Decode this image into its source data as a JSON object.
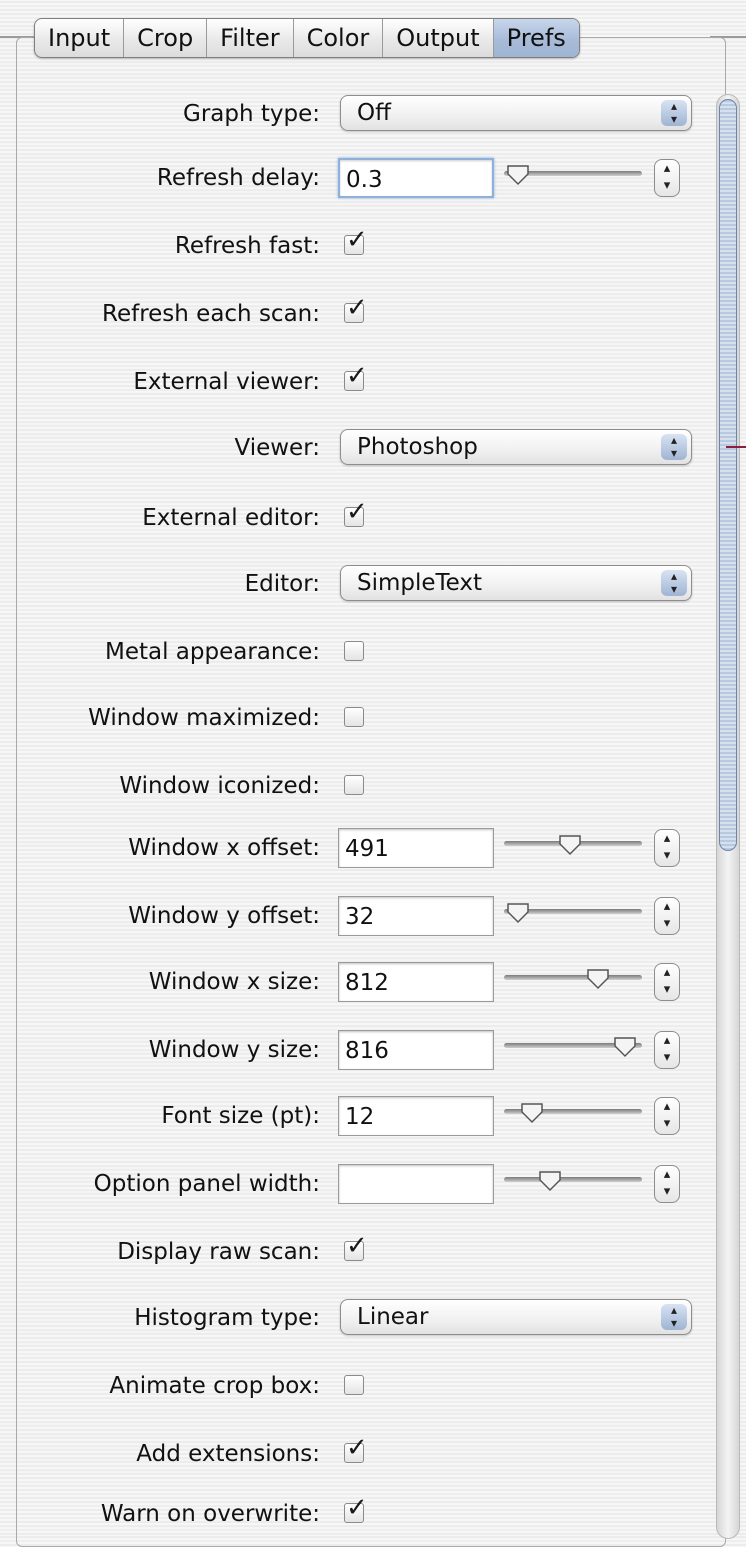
{
  "tabs": [
    {
      "label": "Input",
      "active": false
    },
    {
      "label": "Crop",
      "active": false
    },
    {
      "label": "Filter",
      "active": false
    },
    {
      "label": "Color",
      "active": false
    },
    {
      "label": "Output",
      "active": false
    },
    {
      "label": "Prefs",
      "active": true
    }
  ],
  "prefs": {
    "graph_type": {
      "label": "Graph type:",
      "value": "Off"
    },
    "refresh_delay": {
      "label": "Refresh delay:",
      "value": "0.3",
      "slider_fraction": 0.1
    },
    "refresh_fast": {
      "label": "Refresh fast:",
      "checked": true
    },
    "refresh_each_scan": {
      "label": "Refresh each scan:",
      "checked": true
    },
    "external_viewer": {
      "label": "External viewer:",
      "checked": true
    },
    "viewer": {
      "label": "Viewer:",
      "value": "Photoshop"
    },
    "external_editor": {
      "label": "External editor:",
      "checked": true
    },
    "editor": {
      "label": "Editor:",
      "value": "SimpleText"
    },
    "metal_appearance": {
      "label": "Metal appearance:",
      "checked": false
    },
    "window_maximized": {
      "label": "Window maximized:",
      "checked": false
    },
    "window_iconized": {
      "label": "Window iconized:",
      "checked": false
    },
    "window_x_offset": {
      "label": "Window x offset:",
      "value": "491",
      "slider_fraction": 0.48
    },
    "window_y_offset": {
      "label": "Window y offset:",
      "value": "32",
      "slider_fraction": 0.1
    },
    "window_x_size": {
      "label": "Window x size:",
      "value": "812",
      "slider_fraction": 0.68
    },
    "window_y_size": {
      "label": "Window y size:",
      "value": "816",
      "slider_fraction": 0.88
    },
    "font_size": {
      "label": "Font size (pt):",
      "value": "12",
      "slider_fraction": 0.2
    },
    "option_panel_width": {
      "label": "Option panel width:",
      "value": "",
      "slider_fraction": 0.33
    },
    "display_raw_scan": {
      "label": "Display raw scan:",
      "checked": true
    },
    "histogram_type": {
      "label": "Histogram type:",
      "value": "Linear"
    },
    "animate_crop_box": {
      "label": "Animate crop box:",
      "checked": false
    },
    "add_extensions": {
      "label": "Add extensions:",
      "checked": true
    },
    "warn_on_overwrite": {
      "label": "Warn on overwrite:",
      "checked": true
    }
  },
  "colors": {
    "accent": "#9fb4d3",
    "pointer_line": "#8a1f3f"
  },
  "icons": {
    "checkmark": "check-icon",
    "popup_arrows": "up-down-arrows-icon",
    "stepper": "stepper-arrows-icon"
  }
}
